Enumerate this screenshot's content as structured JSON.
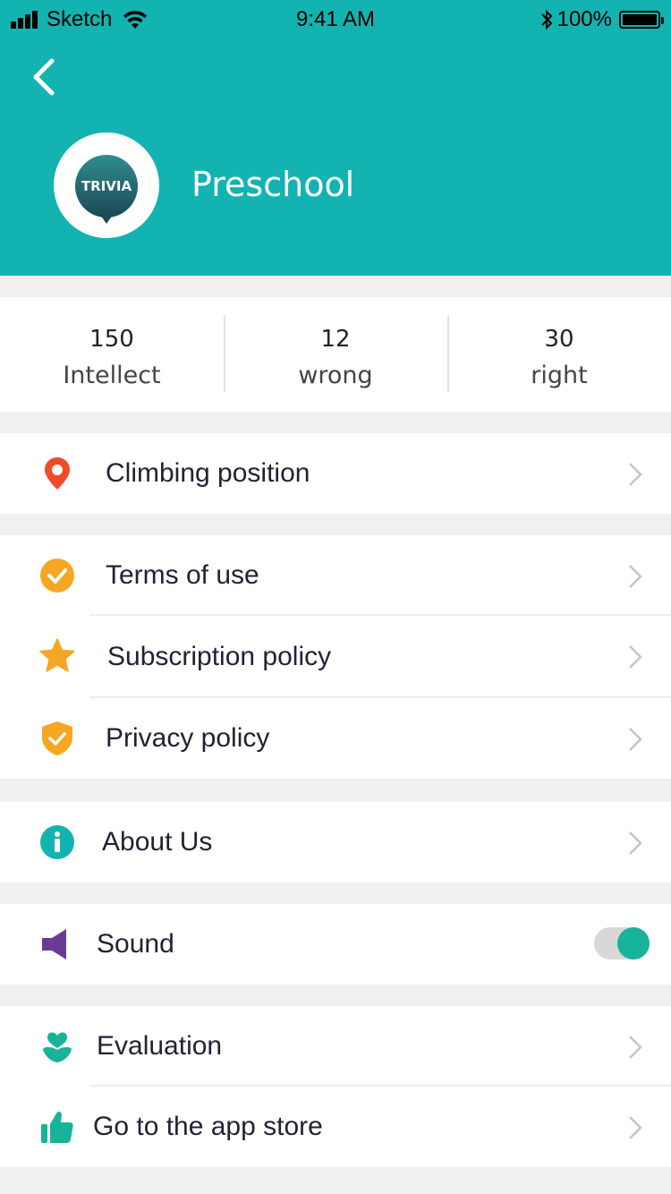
{
  "status_bar": {
    "carrier": "Sketch",
    "time": "9:41 AM",
    "battery": "100%"
  },
  "profile": {
    "logo_text": "TRIVIA",
    "name": "Preschool"
  },
  "stats": [
    {
      "value": "150",
      "label": "Intellect"
    },
    {
      "value": "12",
      "label": "wrong"
    },
    {
      "value": "30",
      "label": "right"
    }
  ],
  "menu": {
    "climbing_position": "Climbing position",
    "terms_of_use": "Terms of use",
    "subscription_policy": "Subscription policy",
    "privacy_policy": "Privacy policy",
    "about_us": "About Us",
    "sound": "Sound",
    "sound_enabled": true,
    "evaluation": "Evaluation",
    "app_store": "Go to the app store"
  },
  "colors": {
    "header": "#12b3b0",
    "location_icon": "#f04b2b",
    "orange_icons": "#f5a623",
    "info_icon": "#12b3b0",
    "sound_icon": "#6b3a93",
    "green_icons": "#17b49a"
  },
  "icons": {
    "back": "chevron-left-icon",
    "climbing_position": "location-pin-icon",
    "terms_of_use": "check-circle-icon",
    "subscription_policy": "star-icon",
    "privacy_policy": "shield-check-icon",
    "about_us": "info-icon",
    "sound": "speaker-icon",
    "evaluation": "flower-icon",
    "app_store": "thumbs-up-icon"
  }
}
